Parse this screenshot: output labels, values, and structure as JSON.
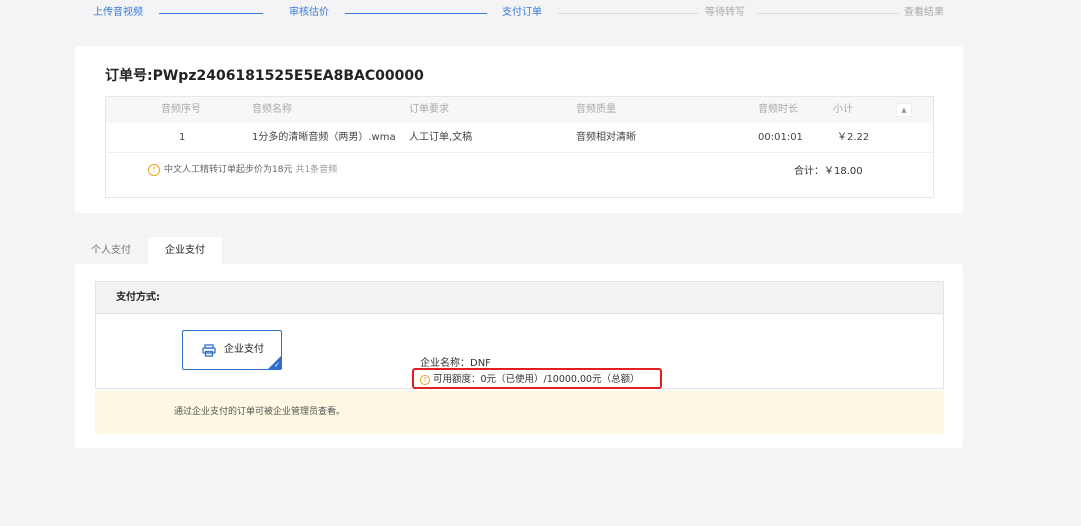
{
  "steps": [
    "上传音视频",
    "审核估价",
    "支付订单",
    "等待转写",
    "查看结果"
  ],
  "order": {
    "title": "订单号:PWpz2406181525E5EA8BAC00000",
    "columns": [
      "音频序号",
      "音频名称",
      "订单要求",
      "音频质量",
      "音频时长",
      "小计"
    ],
    "sort_glyph": "▲",
    "rows": [
      [
        "1",
        "1分多的清晰音频（两男）.wma",
        "人工订单,文稿",
        "音频相对清晰",
        "00:01:01",
        "￥2.22"
      ]
    ],
    "notice_icon": "!",
    "notice": "中文人工精转订单起步价为18元",
    "count": "共1条音频",
    "total": "合计：￥18.00"
  },
  "tabs": [
    "个人支付",
    "企业支付"
  ],
  "payment": {
    "method_label": "支付方式:",
    "button_label": "企业支付",
    "check": "✓",
    "company": "企业名称：DNF",
    "quota_icon": "?",
    "quota": "可用额度：0元（已使用）/10000.00元（总额）",
    "note": "通过企业支付的订单可被企业管理员查看。"
  },
  "colors": {
    "accent": "#3a7bd5",
    "highlight": "#e02020",
    "warning": "#f0a020",
    "note_bg": "#fdf8e1"
  },
  "icons": [
    "printer-icon",
    "warning-icon",
    "question-icon",
    "check-icon"
  ]
}
